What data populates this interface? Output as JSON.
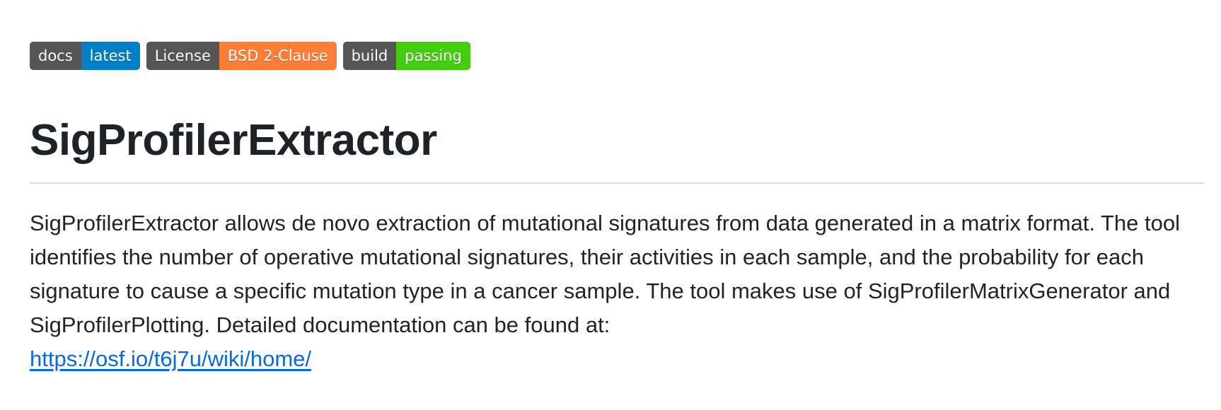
{
  "badges": [
    {
      "left": "docs",
      "right": "latest",
      "color": "#007ec6"
    },
    {
      "left": "License",
      "right": "BSD 2-Clause",
      "color": "#fe7d37"
    },
    {
      "left": "build",
      "right": "passing",
      "color": "#44cc11"
    }
  ],
  "readme": {
    "title": "SigProfilerExtractor",
    "description": "SigProfilerExtractor allows de novo extraction of mutational signatures from data generated in a matrix format. The tool identifies the number of operative mutational signatures, their activities in each sample, and the probability for each signature to cause a specific mutation type in a cancer sample. The tool makes use of SigProfilerMatrixGenerator and SigProfilerPlotting. Detailed documentation can be found at:",
    "link": "https://osf.io/t6j7u/wiki/home/"
  },
  "colors": {
    "text": "#1f2328",
    "link": "#0969da",
    "rule": "#d8dee4"
  }
}
